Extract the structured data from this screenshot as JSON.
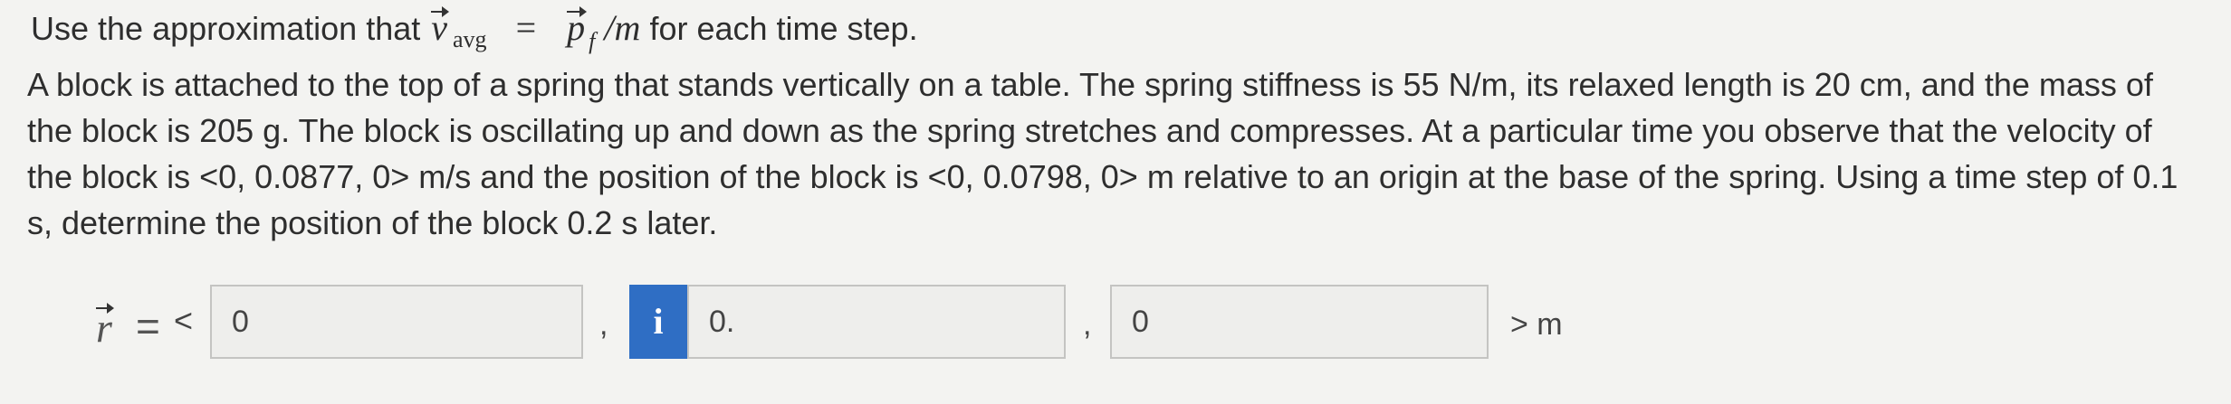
{
  "hint": {
    "prefix": "Use the approximation that ",
    "v_symbol": "v",
    "v_subscript": "avg",
    "equals": "=",
    "p_symbol": "p",
    "p_subscript": "f",
    "divider": "/",
    "m_symbol": "m",
    "suffix": " for each time step."
  },
  "problem_text": "A block is attached to the top of a spring that stands vertically on a table. The spring stiffness is 55 N/m, its relaxed length is 20 cm, and the mass of the block is 205 g. The block is oscillating up and down as the spring stretches and compresses. At a particular time you observe that the velocity of the block is <0, 0.0877, 0> m/s and the position of the block is <0, 0.0798, 0> m relative to an origin at the base of the spring. Using a time step of 0.1 s, determine the position of the block 0.2 s later.",
  "answer": {
    "vector_symbol": "r",
    "equals": "=",
    "open_bracket": "<",
    "x_value": "0",
    "separator_1": ",",
    "info_icon_glyph": "i",
    "y_value": "0.",
    "separator_2": ",",
    "z_value": "0",
    "unit": "> m"
  },
  "colors": {
    "background": "#f3f3f1",
    "input_fill": "#eeeeec",
    "input_border": "#c4c4c2",
    "info_accent": "#2f6ec4"
  },
  "icons": {
    "info": "info-icon"
  }
}
